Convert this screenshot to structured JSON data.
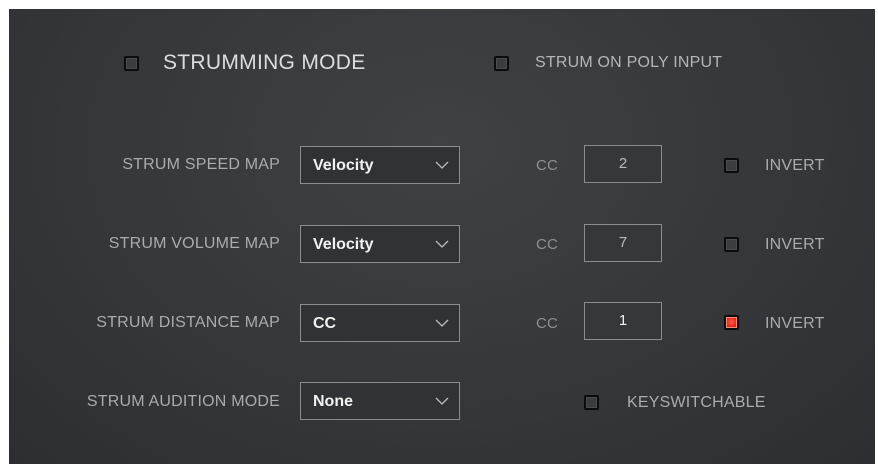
{
  "top": {
    "strumming_mode": {
      "label": "STRUMMING MODE",
      "checked": false
    },
    "strum_on_poly_input": {
      "label": "STRUM ON POLY INPUT",
      "checked": false
    }
  },
  "rows": [
    {
      "label": "STRUM SPEED MAP",
      "select": "Velocity",
      "cc_label": "CC",
      "cc_value": "2",
      "invert_label": "INVERT",
      "invert_checked": false
    },
    {
      "label": "STRUM VOLUME MAP",
      "select": "Velocity",
      "cc_label": "CC",
      "cc_value": "7",
      "invert_label": "INVERT",
      "invert_checked": false
    },
    {
      "label": "STRUM DISTANCE MAP",
      "select": "CC",
      "cc_label": "CC",
      "cc_value": "1",
      "invert_label": "INVERT",
      "invert_checked": true
    }
  ],
  "audition": {
    "label": "STRUM AUDITION MODE",
    "select": "None"
  },
  "keyswitchable": {
    "label": "KEYSWITCHABLE",
    "checked": false
  },
  "colors": {
    "panel": "#35373a",
    "checkbox_on": "#e0281c",
    "text": "#a9abae"
  }
}
